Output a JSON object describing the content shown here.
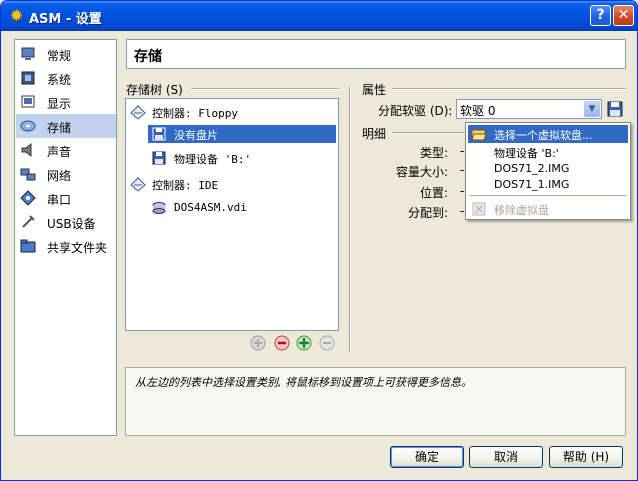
{
  "window": {
    "title": "ASM - 设置",
    "help_glyph": "?",
    "close_glyph": "✕",
    "app_icon": "gear-icon"
  },
  "nav": {
    "items": [
      {
        "label": "常规",
        "icon": "monitor-icon"
      },
      {
        "label": "系统",
        "icon": "chip-icon"
      },
      {
        "label": "显示",
        "icon": "display-icon"
      },
      {
        "label": "存储",
        "icon": "disk-icon",
        "selected": true
      },
      {
        "label": "声音",
        "icon": "speaker-icon"
      },
      {
        "label": "网络",
        "icon": "network-icon"
      },
      {
        "label": "串口",
        "icon": "serial-port-icon"
      },
      {
        "label": "USB设备",
        "icon": "usb-icon"
      },
      {
        "label": "共享文件夹",
        "icon": "folder-icon"
      }
    ]
  },
  "page": {
    "title": "存储"
  },
  "storage_tree": {
    "label": "存储树 (S)",
    "rows": [
      {
        "label": "控制器: Floppy",
        "icon": "controller-icon"
      },
      {
        "label": "没有盘片",
        "icon": "floppy-icon",
        "selected": true
      },
      {
        "label": "物理设备 'B:'",
        "icon": "floppy-icon"
      },
      {
        "label": "控制器: IDE",
        "icon": "controller-icon"
      },
      {
        "label": "DOS4ASM.vdi",
        "icon": "hard-disk-icon"
      }
    ]
  },
  "attributes": {
    "label": "属性",
    "floppy_label": "分配软驱 (D):",
    "floppy_value": "软驱 0",
    "detail_label": "明细",
    "fields": [
      {
        "label": "类型:",
        "value": "-"
      },
      {
        "label": "容量大小:",
        "value": "-"
      },
      {
        "label": "位置:",
        "value": "-"
      },
      {
        "label": "分配到:",
        "value": "-"
      }
    ]
  },
  "dropdown": {
    "items": [
      {
        "label": "选择一个虚拟软盘...",
        "icon": "folder-open-icon",
        "selected": true
      },
      {
        "label": "物理设备 'B:'"
      },
      {
        "label": "DOS71_2.IMG"
      },
      {
        "label": "DOS71_1.IMG"
      }
    ],
    "remove_label": "移除虚拟盘"
  },
  "info_text": "从左边的列表中选择设置类别, 将鼠标移到设置项上可获得更多信息。",
  "buttons": {
    "ok": "确定",
    "cancel": "取消",
    "help": "帮助 (H)"
  }
}
